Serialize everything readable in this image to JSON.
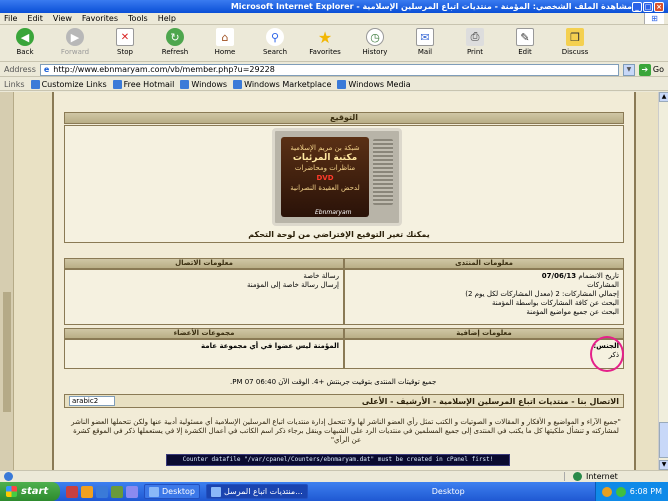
{
  "window": {
    "title": "مشاهدة الملف الشخصي: المؤمنة - منتديات اتباع المرسلين الإسلامية - Microsoft Internet Explorer"
  },
  "menu": [
    "File",
    "Edit",
    "View",
    "Favorites",
    "Tools",
    "Help"
  ],
  "toolbar": {
    "back": "Back",
    "forward": "Forward",
    "stop": "Stop",
    "refresh": "Refresh",
    "home": "Home",
    "search": "Search",
    "favorites": "Favorites",
    "history": "History",
    "mail": "Mail",
    "print": "Print",
    "edit": "Edit",
    "discuss": "Discuss"
  },
  "address": {
    "label": "Address",
    "url": "http://www.ebnmaryam.com/vb/member.php?u=29228",
    "go": "Go"
  },
  "links": {
    "label": "Links",
    "items": [
      "Customize Links",
      "Free Hotmail",
      "Windows",
      "Windows Marketplace",
      "Windows Media"
    ]
  },
  "page": {
    "signature_header": "التوقيع",
    "banner": {
      "line1": "شبكة بن مريم الإسلامية",
      "line2": "مكتبة المرئيات",
      "line3": "مناظرات ومحاضرات",
      "line4": "DVD",
      "line5": "لدحض العقيدة النصرانية",
      "logo": "Ebnmaryam"
    },
    "signature_caption": "يمكنك تغير التوقيع الإفتراضي من لوحة التحكم",
    "forum_info_header": "معلومات المنتدى",
    "contact_info_header": "معلومات الاتصال",
    "join_date_label": "تاريخ الانضمام",
    "join_date": "07/06/13",
    "posts_label": "المشاركات",
    "total_posts": "إجمالي المشاركات: 2 (معدل المشاركات لكل يوم 2)",
    "find_posts": "البحث عن كافة المشاركات بواسطة المؤمنة",
    "find_threads": "البحث عن جميع مواضيع المؤمنة",
    "private_msg_label": "رسالة خاصة",
    "send_pm": "إرسال رسالة خاصة إلى المؤمنة",
    "extra_info_header": "معلومات إضافية",
    "groups_header": "مجموعات الأعضاء",
    "gender_label": "الجنس:",
    "gender_value": "ذكر",
    "groups_value": "المؤمنة ليس عضوا في أي مجموعة عامة",
    "timeline": "جميع توقيتات المنتدى بتوقيت جرينتش +4. الوقت الآن 06:40 PM 07.",
    "footer_link": "الاتصال بنا - منتديات اتباع المرسلين الإسلامية - الأرشيف - الأعلى",
    "style_select": "arabic2",
    "disclaimer": "\"جميع الآراء و المواضيع و الأفكار و المقالات و الصوتيات و الكتب تمثل رأي العضو الناشر لها ولا تتحمل إدارة منتديات اتباع المرسلين الإسلامية أي مسئولية أدبية عنها ولكن تتحملها العضو الناشر لمشاركته و تنشأل ملكيتها كل ما يكتب في المنتدى إلى جميع المسلمين في منتديات الرد على الشبهات وينقل برجاء ذكر اسم الكاتب في أعمال الكشرة إلا في يستعملها ذكر في الموقع كشرة عن الرأي\"",
    "counter": "Counter datafile \"/var/cpanel/Counters/ebnmaryam.dat\" must be created in cPanel first!"
  },
  "status": {
    "left": "",
    "zone": "Internet"
  },
  "taskbar": {
    "start": "start",
    "desktop_task": "Desktop",
    "ie_task": "منتديات اتباع المرسل...",
    "desktop_label": "Desktop",
    "clock": "6:08 PM"
  }
}
